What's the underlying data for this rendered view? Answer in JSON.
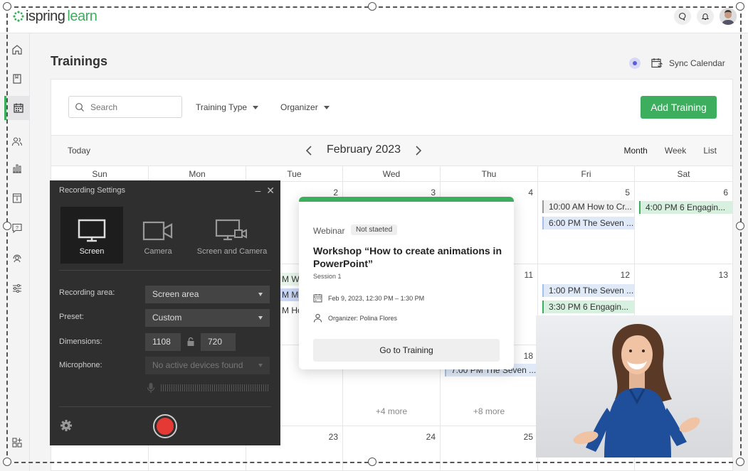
{
  "header": {
    "logo_text_1": "ispring",
    "logo_text_2": "learn"
  },
  "page": {
    "title": "Trainings",
    "sync_label": "Sync Calendar"
  },
  "filters": {
    "search_placeholder": "Search",
    "training_type": "Training Type",
    "organizer": "Organizer",
    "add_button": "Add Training"
  },
  "calendar": {
    "today": "Today",
    "month_label": "February 2023",
    "views": [
      "Month",
      "Week",
      "List"
    ],
    "weekdays": [
      "Sun",
      "Mon",
      "Tue",
      "Wed",
      "Thu",
      "Fri",
      "Sat"
    ],
    "day_numbers": {
      "tue_w1": "2",
      "wed_w1": "3",
      "thu_w1": "4",
      "fri_w1": "5",
      "sat_w1": "6",
      "thu_w2": "11",
      "fri_w2": "12",
      "sat_w2": "13",
      "thu_w3": "18",
      "tue_w4": "23",
      "wed_w4": "24",
      "thu_w4": "25"
    },
    "events": {
      "fri5_a": "10:00 AM How to Cr...",
      "fri5_b": "6:00 PM The Seven ...",
      "sat6_a": "4:00 PM 6 Engagin...",
      "tue_w2_a": "M Wo",
      "tue_w2_b": "M Mo",
      "tue_w2_c": "M Ho",
      "fri12_a": "1:00 PM The Seven ...",
      "fri12_b": "3:30 PM 6 Engagin...",
      "thu18_a": "7:00 PM The Seven ..."
    },
    "more_wed": "+4 more",
    "more_thu": "+8 more"
  },
  "recording": {
    "title": "Recording Settings",
    "modes": [
      "Screen",
      "Camera",
      "Screen and Camera"
    ],
    "area_label": "Recording area:",
    "area_value": "Screen area",
    "preset_label": "Preset:",
    "preset_value": "Custom",
    "dimensions_label": "Dimensions:",
    "width": "1108",
    "height": "720",
    "mic_label": "Microphone:",
    "mic_value": "No active devices found"
  },
  "popup": {
    "type": "Webinar",
    "status": "Not staeted",
    "title": "Workshop “How to create animations in PowerPoint”",
    "session": "Session 1",
    "datetime": "Feb 9, 2023, 12:30 PM – 1:30 PM",
    "organizer": "Organizer: Polina Flores",
    "button": "Go to Training"
  },
  "colors": {
    "accent": "#3cae5e",
    "record": "#e53935"
  }
}
